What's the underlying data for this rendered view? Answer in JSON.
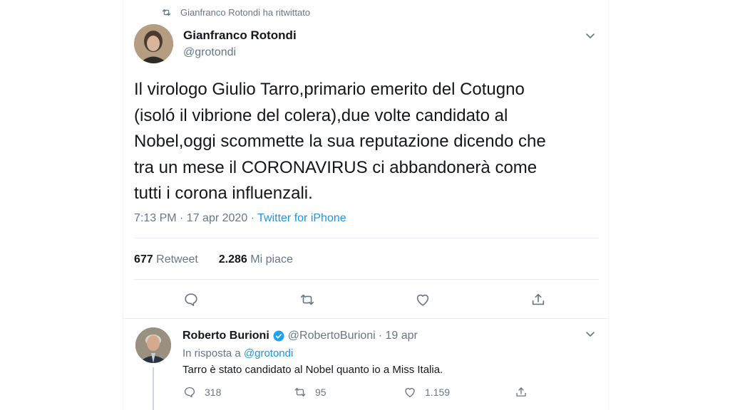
{
  "retweet_context": {
    "icon": "retweet-icon",
    "text": "Gianfranco Rotondi ha ritwittato"
  },
  "tweet": {
    "author_name": "Gianfranco Rotondi",
    "author_handle": "@grotondi",
    "text_lines": [
      "Il virologo Giulio Tarro,primario emerito del Cotugno",
      "(isoló il vibrione del colera),due volte candidato al",
      "Nobel,oggi scommette la sua reputazione dicendo che",
      "tra un mese il CORONAVIRUS ci abbandonerà come",
      "tutti i corona influenzali."
    ],
    "time": "7:13 PM · 17 apr 2020 · ",
    "source": "Twitter for iPhone",
    "retweets_count": "677",
    "retweets_label": "Retweet",
    "likes_count": "2.286",
    "likes_label": "Mi piace",
    "actions": [
      "reply-icon",
      "retweet-icon",
      "like-icon",
      "share-icon"
    ]
  },
  "reply": {
    "author_name": "Roberto Burioni",
    "author_handle": "@RobertoBurioni",
    "date": "· 19 apr",
    "in_reply_prefix": "In risposta a",
    "in_reply_mention": "@grotondi",
    "text": "Tarro è stato candidato al Nobel quanto io a Miss Italia.",
    "reply_count": "318",
    "retweet_count": "95",
    "like_count": "1.159"
  },
  "colors": {
    "link": "#1b95e0",
    "secondary_text": "#657786",
    "primary_text": "#14171a",
    "divider": "#e6ecf0"
  }
}
